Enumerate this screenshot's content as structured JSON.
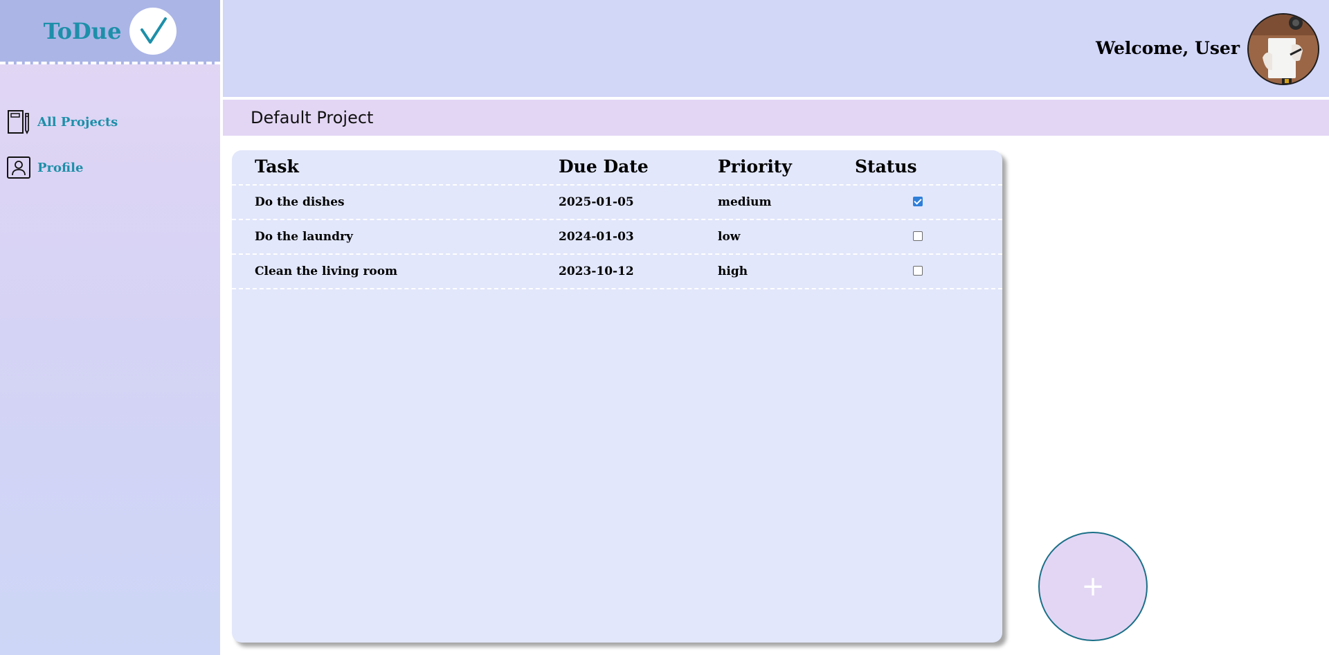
{
  "app": {
    "name": "ToDue",
    "brand_color": "#1d8fa9"
  },
  "sidebar": {
    "items": [
      {
        "label": "All Projects",
        "icon": "notebook-pen-icon"
      },
      {
        "label": "Profile",
        "icon": "user-profile-icon"
      }
    ]
  },
  "header": {
    "welcome": "Welcome, User",
    "avatar": "user-avatar-photo"
  },
  "project": {
    "title": "Default Project"
  },
  "table": {
    "columns": [
      "Task",
      "Due Date",
      "Priority",
      "Status"
    ],
    "rows": [
      {
        "task": "Do the dishes",
        "due": "2025-01-05",
        "priority": "medium",
        "done": true
      },
      {
        "task": "Do the laundry",
        "due": "2024-01-03",
        "priority": "low",
        "done": false
      },
      {
        "task": "Clean the living room",
        "due": "2023-10-12",
        "priority": "high",
        "done": false
      }
    ]
  },
  "add_button": {
    "icon": "plus-icon",
    "glyph": "+"
  }
}
